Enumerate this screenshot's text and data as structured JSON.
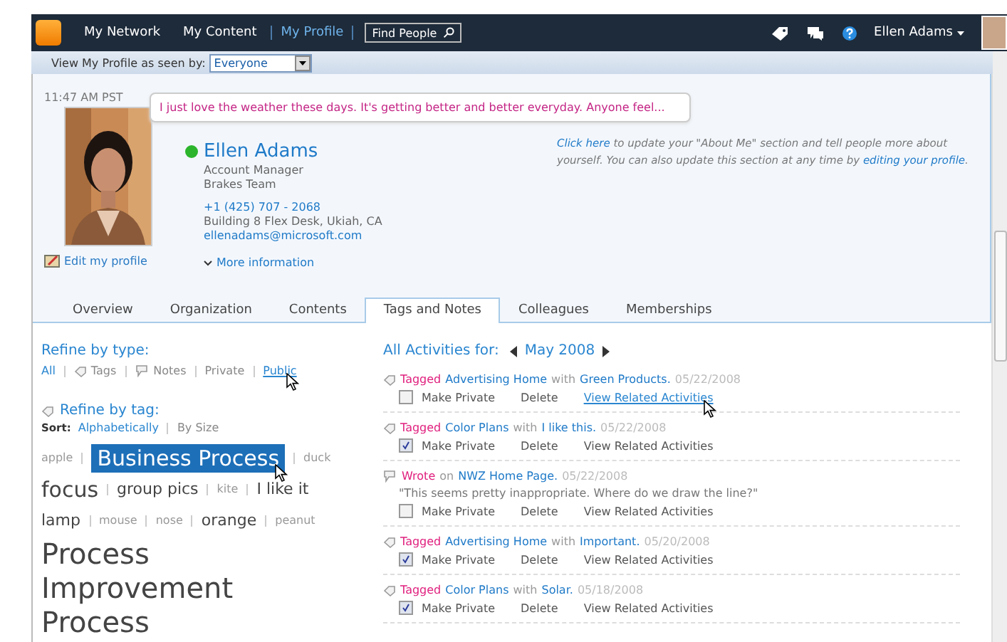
{
  "nav": {
    "items": [
      {
        "label": "My Network",
        "selected": false
      },
      {
        "label": "My Content",
        "selected": false
      },
      {
        "label": "My Profile",
        "selected": true
      }
    ],
    "find_people": "Find People",
    "user": "Ellen Adams"
  },
  "view_as": {
    "label": "View My Profile as seen by:",
    "value": "Everyone"
  },
  "profile": {
    "time": "11:47 AM PST",
    "status": "I just love the weather these days. It's getting better and better everyday. Anyone feel...",
    "online": true,
    "name": "Ellen Adams",
    "title": "Account Manager",
    "team": "Brakes Team",
    "phone": "+1 (425) 707 - 2068",
    "office": "Building 8 Flex Desk, Ukiah, CA",
    "email": "ellenadams@microsoft.com",
    "edit": "Edit my profile",
    "more": "More information",
    "about": [
      {
        "text": "Click here",
        "kind": "link"
      },
      {
        "text": " to update your \"About Me\" section and tell people more about yourself. You can also update this section at any time by ",
        "kind": "text"
      },
      {
        "text": "editing your profile",
        "kind": "link"
      },
      {
        "text": ".",
        "kind": "text"
      }
    ]
  },
  "tabs": [
    {
      "label": "Overview",
      "selected": false
    },
    {
      "label": "Organization",
      "selected": false
    },
    {
      "label": "Contents",
      "selected": false
    },
    {
      "label": "Tags and Notes",
      "selected": true
    },
    {
      "label": "Colleagues",
      "selected": false
    },
    {
      "label": "Memberships",
      "selected": false
    }
  ],
  "refine_type": {
    "title": "Refine by type:",
    "items": [
      {
        "label": "All",
        "kind": "plain",
        "selected": true,
        "hovered": false
      },
      {
        "label": "Tags",
        "kind": "tag",
        "selected": false,
        "hovered": false
      },
      {
        "label": "Notes",
        "kind": "note",
        "selected": false,
        "hovered": false
      },
      {
        "label": "Private",
        "kind": "plain",
        "selected": false,
        "hovered": false
      },
      {
        "label": "Public",
        "kind": "plain",
        "selected": false,
        "hovered": true
      }
    ]
  },
  "refine_tag": {
    "title": "Refine by tag:",
    "sort_label": "Sort:",
    "sorts": [
      {
        "label": "Alphabetically",
        "selected": true
      },
      {
        "label": "By Size",
        "selected": false
      }
    ],
    "lines": [
      [
        {
          "label": "apple",
          "kind": "small",
          "selected": false
        },
        {
          "label": "Business Process",
          "kind": "large",
          "selected": true
        },
        {
          "label": "duck",
          "kind": "small",
          "selected": false
        }
      ],
      [
        {
          "label": "focus",
          "kind": "large",
          "selected": false
        },
        {
          "label": "group pics",
          "kind": "medium",
          "selected": false
        },
        {
          "label": "kite",
          "kind": "small",
          "selected": false
        },
        {
          "label": "I like it",
          "kind": "medium",
          "selected": false
        }
      ],
      [
        {
          "label": "lamp",
          "kind": "medium",
          "selected": false
        },
        {
          "label": "mouse",
          "kind": "small",
          "selected": false
        },
        {
          "label": "nose",
          "kind": "small",
          "selected": false
        },
        {
          "label": "orange",
          "kind": "medium",
          "selected": false
        },
        {
          "label": "peanut",
          "kind": "small",
          "selected": false
        }
      ],
      [
        {
          "label": "Process Improvement Process",
          "kind": "xlarge",
          "selected": false
        }
      ]
    ]
  },
  "activities": {
    "title": "All Activities for:",
    "month": "May 2008",
    "items": [
      {
        "kind": "tag",
        "verb": "Tagged",
        "target": "Advertising Home",
        "joiner": "with",
        "tag": "Green Products.",
        "date": "05/22/2008",
        "private": false,
        "private_label": "Make Private",
        "delete": "Delete",
        "related": "View Related Activities",
        "hovered": true
      },
      {
        "kind": "tag",
        "verb": "Tagged",
        "target": "Color Plans",
        "joiner": "with",
        "tag": "I like this.",
        "date": "05/22/2008",
        "private": true,
        "private_label": "Make Private",
        "delete": "Delete",
        "related": "View Related Activities",
        "hovered": false
      },
      {
        "kind": "note",
        "verb": "Wrote",
        "joiner": "on",
        "tag": "NWZ Home Page.",
        "date": "05/22/2008",
        "quote": "\"This seems pretty inappropriate. Where do we draw the line?\"",
        "private": false,
        "private_label": "Make Private",
        "delete": "Delete",
        "related": "View Related Activities",
        "hovered": false
      },
      {
        "kind": "tag",
        "verb": "Tagged",
        "target": "Advertising Home",
        "joiner": "with",
        "tag": "Important.",
        "date": "05/20/2008",
        "private": true,
        "private_label": "Make Private",
        "delete": "Delete",
        "related": "View Related Activities",
        "hovered": false
      },
      {
        "kind": "tag",
        "verb": "Tagged",
        "target": "Color Plans",
        "joiner": "with",
        "tag": "Solar.",
        "date": "05/18/2008",
        "private": true,
        "private_label": "Make Private",
        "delete": "Delete",
        "related": "View Related Activities",
        "hovered": false
      }
    ]
  }
}
